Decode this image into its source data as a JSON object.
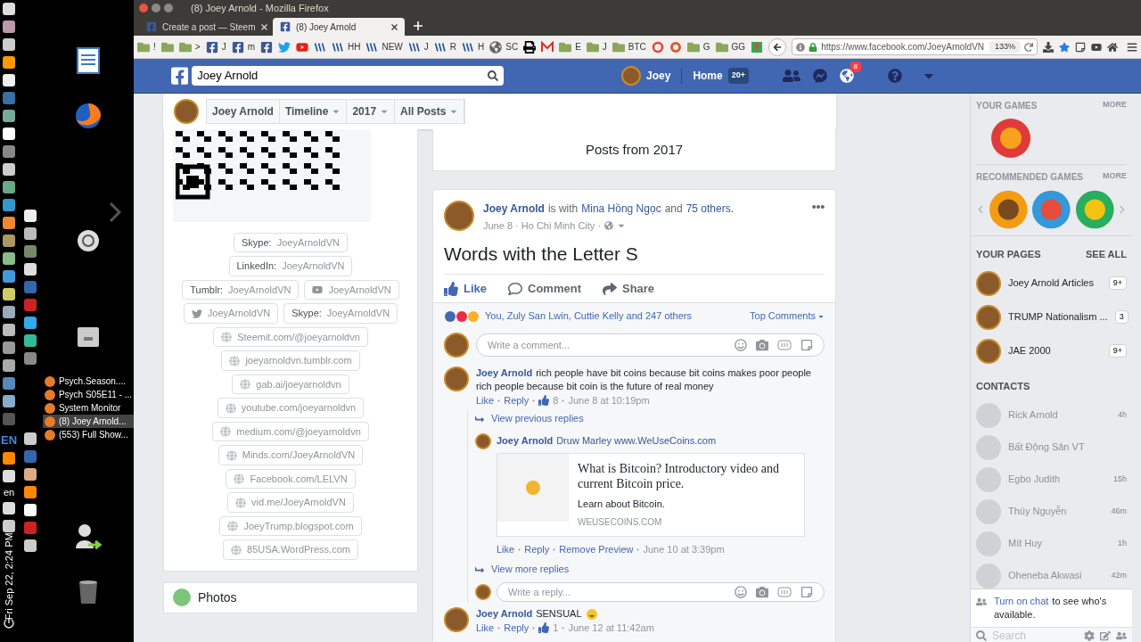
{
  "desktop": {
    "input_language": "EN",
    "keyboard": "en",
    "clock": "Fri Sep 22, 2:24 PM",
    "windows": [
      {
        "title": "Psych.Season....",
        "selected": false
      },
      {
        "title": "Psych S05E11 - ...",
        "selected": false
      },
      {
        "title": "System Monitor",
        "selected": false
      },
      {
        "title": "(8) Joey Arnold...",
        "selected": true
      },
      {
        "title": "(553) Full Show...",
        "selected": false
      }
    ]
  },
  "window": {
    "title": "(8) Joey Arnold - Mozilla Firefox"
  },
  "tabs": [
    {
      "title": "Create a post — Steem",
      "selected": false
    },
    {
      "title": "(8) Joey Arnold",
      "selected": true
    }
  ],
  "bookmarks": [
    {
      "kind": "folder",
      "label": "!"
    },
    {
      "kind": "folder"
    },
    {
      "kind": "folder",
      "label": ">"
    },
    {
      "kind": "facebook",
      "label": "J"
    },
    {
      "kind": "facebook",
      "label": "m"
    },
    {
      "kind": "facebook"
    },
    {
      "kind": "twitter"
    },
    {
      "kind": "youtube"
    },
    {
      "kind": "steem"
    },
    {
      "kind": "steem",
      "label": "HH"
    },
    {
      "kind": "steem",
      "label": "NEW"
    },
    {
      "kind": "steem",
      "label": "J"
    },
    {
      "kind": "steem",
      "label": "R"
    },
    {
      "kind": "steem",
      "label": "H"
    },
    {
      "kind": "globe",
      "label": "SC"
    },
    {
      "kind": "printer"
    },
    {
      "kind": "gmail"
    },
    {
      "kind": "folder",
      "label": "E"
    },
    {
      "kind": "folder",
      "label": "J"
    },
    {
      "kind": "folder",
      "label": "BTC"
    },
    {
      "kind": "google"
    },
    {
      "kind": "duck"
    },
    {
      "kind": "folder",
      "label": "G"
    },
    {
      "kind": "folder",
      "label": "GG"
    },
    {
      "kind": "maps"
    }
  ],
  "address_bar": {
    "url": "https://www.facebook.com/JoeyArnoldVN",
    "zoom": "133%"
  },
  "fb_header": {
    "search": "Joey Arnold",
    "user": "Joey",
    "home": "Home",
    "home_badge": "20+",
    "notifications_badge": "8"
  },
  "timeline_nav": {
    "name": "Joey Arnold",
    "menus": [
      "Timeline",
      "2017",
      "All Posts"
    ]
  },
  "profile_links": [
    {
      "items": [
        {
          "kind": "labeled",
          "label": "Skype:",
          "value": "JoeyArnoldVN"
        }
      ]
    },
    {
      "items": [
        {
          "kind": "labeled",
          "label": "LinkedIn:",
          "value": "JoeyArnoldVN"
        }
      ]
    },
    {
      "items": [
        {
          "kind": "labeled",
          "label": "Tumblr:",
          "value": "JoeyArnoldVN"
        },
        {
          "kind": "youtube",
          "value": "JoeyArnoldVN"
        }
      ]
    },
    {
      "items": [
        {
          "kind": "twitter",
          "value": "JoeyArnoldVN"
        },
        {
          "kind": "labeled",
          "label": "Skype:",
          "value": "JoeyArnoldVN"
        }
      ]
    },
    {
      "items": [
        {
          "kind": "web",
          "value": "Steemit.com/@joeyarnoldvn"
        }
      ]
    },
    {
      "items": [
        {
          "kind": "web",
          "value": "joeyarnoldvn.tumblr.com"
        }
      ]
    },
    {
      "items": [
        {
          "kind": "web",
          "value": "gab.ai/joeyarnoldvn"
        }
      ]
    },
    {
      "items": [
        {
          "kind": "web",
          "value": "youtube.com/joeyarnoldvn"
        }
      ]
    },
    {
      "items": [
        {
          "kind": "web",
          "value": "medium.com/@joeyarnoldvn"
        }
      ]
    },
    {
      "items": [
        {
          "kind": "web",
          "value": "Minds.com/JoeyArnoldVN"
        }
      ]
    },
    {
      "items": [
        {
          "kind": "web",
          "value": "Facebook.com/LELVN"
        }
      ]
    },
    {
      "items": [
        {
          "kind": "web",
          "value": "vid.me/JoeyArnoldVN"
        }
      ]
    },
    {
      "items": [
        {
          "kind": "web",
          "value": "JoeyTrump.blogspot.com"
        }
      ]
    },
    {
      "items": [
        {
          "kind": "web",
          "value": "85USA.WordPress.com"
        }
      ]
    }
  ],
  "photos_heading": "Photos",
  "posts_heading": "Posts from 2017",
  "post": {
    "author": "Joey Arnold",
    "with_text": "is with",
    "friend": "Mina Hồng Ngọc",
    "and_text": "and",
    "others": "75 others.",
    "meta": "June 8 · Ho Chi Minh City ·",
    "title": "Words with the Letter S",
    "actions": [
      {
        "kind": "like",
        "label": "Like",
        "selected": true
      },
      {
        "kind": "comment",
        "label": "Comment",
        "selected": false
      },
      {
        "kind": "share",
        "label": "Share",
        "selected": false
      }
    ],
    "reactions": "You, Zuly San Lwin, Cuttie Kelly and 247 others",
    "sort": "Top Comments",
    "comment_placeholder": "Write a comment...",
    "comments": [
      {
        "author": "Joey Arnold",
        "text": "rich people have bit coins because bit coins makes poor people rich people because bit coin is the future of real money",
        "emoji": false,
        "actions": [
          "Like",
          "Reply"
        ],
        "likes": "8",
        "time": "June 8 at 10:19pm",
        "view_previous": "View previous replies",
        "replies": [
          {
            "author": "Joey Arnold",
            "text": "Druw Marley www.WeUseCoins.com",
            "preview": {
              "title": "What is Bitcoin? Introductory video and current Bitcoin price.",
              "description": "Learn about Bitcoin.",
              "domain": "WEUSECOINS.COM"
            },
            "actions": [
              "Like",
              "Reply",
              "Remove Preview"
            ],
            "time": "June 10 at 3:39pm"
          }
        ],
        "view_more": "View more replies",
        "reply_placeholder": "Write a reply..."
      },
      {
        "author": "Joey Arnold",
        "text": "SENSUAL",
        "emoji": true,
        "actions": [
          "Like",
          "Reply"
        ],
        "likes": "1",
        "time": "June 12 at 11:42am"
      }
    ]
  },
  "sidebar": {
    "games_heading": "YOUR GAMES",
    "games_more": "MORE",
    "recommended_heading": "RECOMMENDED GAMES",
    "recommended_more": "MORE",
    "pages_heading": "YOUR PAGES",
    "pages_see_all": "SEE ALL",
    "pages": [
      {
        "name": "Joey Arnold Articles",
        "badge": "9+"
      },
      {
        "name": "TRUMP Nationalism ...",
        "badge": "3"
      },
      {
        "name": "JAE 2000",
        "badge": "9+"
      }
    ],
    "contacts_heading": "CONTACTS",
    "contacts": [
      {
        "name": "Rick Arnold",
        "time": "4h"
      },
      {
        "name": "Bất Động Sản VT"
      },
      {
        "name": "Egbo Judith",
        "time": "15h"
      },
      {
        "name": "Thúy Nguyễn",
        "time": "46m"
      },
      {
        "name": "Mít Huy",
        "time": "1h"
      },
      {
        "name": "Oheneba Akwasi",
        "time": "42m"
      }
    ],
    "chat_link": "Turn on chat",
    "chat_text": "to see who's available.",
    "search_placeholder": "Search"
  }
}
